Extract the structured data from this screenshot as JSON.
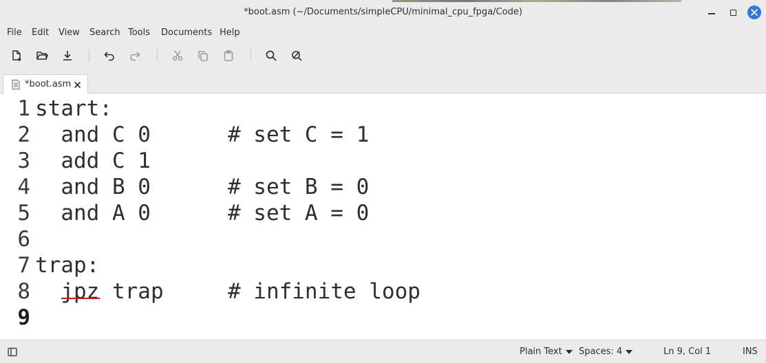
{
  "window": {
    "title": "*boot.asm (~/Documents/simpleCPU/minimal_cpu_fpga/Code)"
  },
  "menubar": {
    "items": [
      "File",
      "Edit",
      "View",
      "Search",
      "Tools",
      "Documents",
      "Help"
    ]
  },
  "toolbar": {
    "buttons": [
      "new-document-icon",
      "open-document-icon",
      "save-icon",
      "undo-icon",
      "redo-icon",
      "cut-icon",
      "copy-icon",
      "paste-icon",
      "search-icon",
      "search-replace-icon"
    ]
  },
  "tabs": [
    {
      "label": "*boot.asm"
    }
  ],
  "editor": {
    "lines": [
      {
        "num": "1",
        "text": "start:"
      },
      {
        "num": "2",
        "text": "  and C 0      # set C = 1"
      },
      {
        "num": "3",
        "text": "  add C 1"
      },
      {
        "num": "4",
        "text": "  and B 0      # set B = 0"
      },
      {
        "num": "5",
        "text": "  and A 0      # set A = 0"
      },
      {
        "num": "6",
        "text": ""
      },
      {
        "num": "7",
        "text": "trap:"
      },
      {
        "num": "8",
        "text": "  jpz trap     # infinite loop"
      },
      {
        "num": "9",
        "text": ""
      }
    ],
    "current_line": 9
  },
  "statusbar": {
    "language": "Plain Text",
    "spaces": "Spaces: 4",
    "position": "Ln 9, Col 1",
    "mode": "INS"
  },
  "colors": {
    "chrome_bg": "#ebebeb",
    "close_button": "#2c7ad6",
    "spell_error": "#c01c28"
  }
}
